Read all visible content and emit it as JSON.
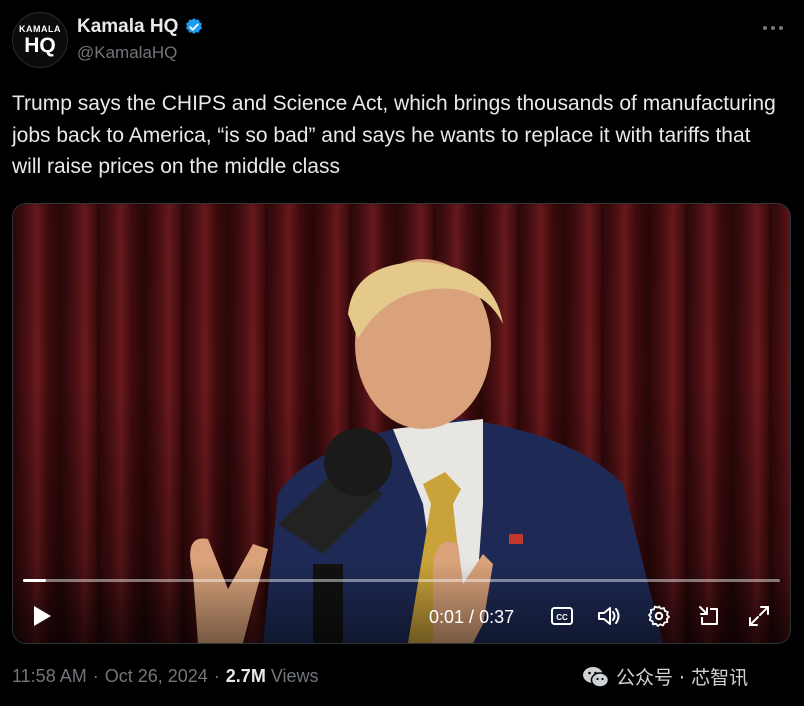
{
  "account": {
    "avatar_line1": "KAMALA",
    "avatar_line2": "HQ",
    "display_name": "Kamala HQ",
    "handle": "@KamalaHQ",
    "verified_color": "#1d9bf0"
  },
  "tweet": {
    "text": "Trump says the CHIPS and Science Act, which brings thousands of manufacturing jobs back to America, “is so bad” and says he wants to replace it with tariffs that will raise prices on the middle class"
  },
  "video": {
    "current_time": "0:01",
    "separator": "/",
    "duration": "0:37",
    "progress_fraction": 0.03,
    "icons": [
      "play-icon",
      "captions-icon",
      "volume-icon",
      "settings-icon",
      "pop-out-icon",
      "fullscreen-icon"
    ]
  },
  "footer": {
    "time": "11:58 AM",
    "date": "Oct 26, 2024",
    "views_count": "2.7M",
    "views_label": "Views",
    "separator": "·"
  },
  "watermark": {
    "text": "公众号 · 芯智讯"
  }
}
